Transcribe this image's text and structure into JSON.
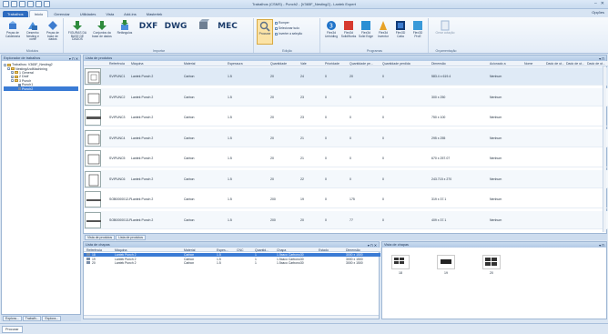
{
  "window": {
    "title": "Trabalhos (CSMS) - Punch2 - [V365F_Nesting2] - Lantek Expert",
    "min": "–",
    "close": "✕"
  },
  "menu": {
    "tabs": [
      "Trabalhos",
      "Início",
      "Gerenciar",
      "Utilidades",
      "Vista",
      "Add-ins",
      "Mastertek"
    ],
    "help": "Opções"
  },
  "ribbon": {
    "modulos": {
      "label": "Módulos",
      "buttons": [
        "Peças de Caldeiraria",
        "Desenho Nesting e corte",
        "Peças de base de dados"
      ]
    },
    "importar": {
      "label": "Importar",
      "buttons": [
        "FIGURAS DA BASE DE DADOS",
        "Conjuntos da base de dados",
        "Retângulos",
        "DXF",
        "DWG",
        "MEC"
      ]
    },
    "edicao": {
      "label": "Edição",
      "process": "Procurar",
      "items": [
        "Romper",
        "Selecionar tudo",
        "Inverter a seleção"
      ]
    },
    "programas": {
      "label": "Programas",
      "buttons": [
        "Flex3d Unfolding",
        "Flex3d SolidWorks",
        "Flex3d Solid Edge",
        "Flex3d Inventor",
        "Flex3D Catia",
        "Flex3D ProE"
      ]
    },
    "orcamentacao": {
      "label": "Orçamentação",
      "button": "Gerar cotação"
    }
  },
  "explorer": {
    "title": "Explorador de trabalhos",
    "pin": "▾ ⊓ ✕",
    "tree": [
      {
        "label": "Trabalhos: V365F_Nesting2",
        "level": 0
      },
      {
        "label": "NestingAndMachining",
        "level": 1
      },
      {
        "label": "1 General",
        "level": 2
      },
      {
        "label": "2 Dxdf",
        "level": 2
      },
      {
        "label": "3 Punch",
        "level": 2
      },
      {
        "label": "Punch1",
        "level": 3
      },
      {
        "label": "Punch2",
        "level": 3
      }
    ],
    "bottom_tabs": [
      "Explora...",
      "Trabalh...",
      "Explora..."
    ]
  },
  "produtos": {
    "title": "Lista de produtos",
    "columns": [
      "Referência",
      "Máquina",
      "Material",
      "Espessura",
      "Quantidade",
      "Vale",
      "Prioridade",
      "Quantidade pe...",
      "Quantidade perdida",
      "Dimensão",
      "Acionado a",
      "Nome",
      "Dado de ut...",
      "Dado de ut...",
      "Dado de ut..."
    ],
    "rows": [
      {
        "ref": "SVIPUNC1",
        "maq": "Lantek Punch 2",
        "mat": "Carbon",
        "esp": "1.5",
        "qtd": "20",
        "vale": "24",
        "prio": "0",
        "qpe": "20",
        "qper": "0",
        "dim": "583.4 x 619.4",
        "acion": "Nenhum"
      },
      {
        "ref": "SVIPUNC2",
        "maq": "Lantek Punch 2",
        "mat": "Carbon",
        "esp": "1.5",
        "qtd": "20",
        "vale": "23",
        "prio": "0",
        "qpe": "0",
        "qper": "0",
        "dim": "300 x 250",
        "acion": "Nenhum"
      },
      {
        "ref": "SVIPUNC3",
        "maq": "Lantek Punch 2",
        "mat": "Carbon",
        "esp": "1.5",
        "qtd": "20",
        "vale": "23",
        "prio": "0",
        "qpe": "0",
        "qper": "0",
        "dim": "750 x 100",
        "acion": "Nenhum"
      },
      {
        "ref": "SVIPUNC4",
        "maq": "Lantek Punch 2",
        "mat": "Carbon",
        "esp": "1.5",
        "qtd": "20",
        "vale": "21",
        "prio": "0",
        "qpe": "0",
        "qper": "0",
        "dim": "295 x 255",
        "acion": "Nenhum"
      },
      {
        "ref": "SVIPUNC5",
        "maq": "Lantek Punch 2",
        "mat": "Carbon",
        "esp": "1.5",
        "qtd": "20",
        "vale": "21",
        "prio": "0",
        "qpe": "0",
        "qper": "0",
        "dim": "670 x 257.07",
        "acion": "Nenhum"
      },
      {
        "ref": "SVIPUNC6",
        "maq": "Lantek Punch 2",
        "mat": "Carbon",
        "esp": "1.5",
        "qtd": "20",
        "vale": "22",
        "prio": "0",
        "qpe": "0",
        "qper": "0",
        "dim": "243.715 x 270",
        "acion": "Nenhum"
      },
      {
        "ref": "SOB0000012-P",
        "maq": "Lantek Punch 2",
        "mat": "Carbon",
        "esp": "1.5",
        "qtd": "200",
        "vale": "19",
        "prio": "0",
        "qpe": "175",
        "qper": "0",
        "dim": "319 x 37.1",
        "acion": "Nenhum"
      },
      {
        "ref": "SOB0000013-P",
        "maq": "Lantek Punch 2",
        "mat": "Carbon",
        "esp": "1.5",
        "qtd": "200",
        "vale": "20",
        "prio": "0",
        "qpe": "77",
        "qper": "0",
        "dim": "409 x 37.1",
        "acion": "Nenhum"
      }
    ]
  },
  "pane_tabs": [
    "Vista de produtos",
    "Lista de produtos"
  ],
  "chapas": {
    "title": "Lista de chapas",
    "columns": [
      "Referência",
      "Máquina",
      "Material",
      "Espes...",
      "CNC",
      "Quantid...",
      "Chapa",
      "Estado",
      "Dimensão"
    ],
    "rows": [
      {
        "ref": "18",
        "maq": "Lantek Punch 2",
        "mat": "Carbon",
        "esp": "1.5",
        "cnc": "",
        "qtd": "1",
        "chapa": "1.5xaco Carbono30",
        "estado": "",
        "dim": "3000 x 1500"
      },
      {
        "ref": "19",
        "maq": "Lantek Punch 2",
        "mat": "Carbon",
        "esp": "1.5",
        "cnc": "",
        "qtd": "1",
        "chapa": "1.5xaco Carbono30",
        "estado": "",
        "dim": "3000 x 1500"
      },
      {
        "ref": "20",
        "maq": "Lantek Punch 2",
        "mat": "Carbon",
        "esp": "1.5",
        "cnc": "",
        "qtd": "1",
        "chapa": "1.5xaco Carbono30",
        "estado": "",
        "dim": "3000 x 1500"
      }
    ]
  },
  "vista": {
    "title": "Vista de chapas",
    "sheets": [
      "18",
      "19",
      "20"
    ]
  },
  "status": {
    "tab": "Procurar"
  }
}
